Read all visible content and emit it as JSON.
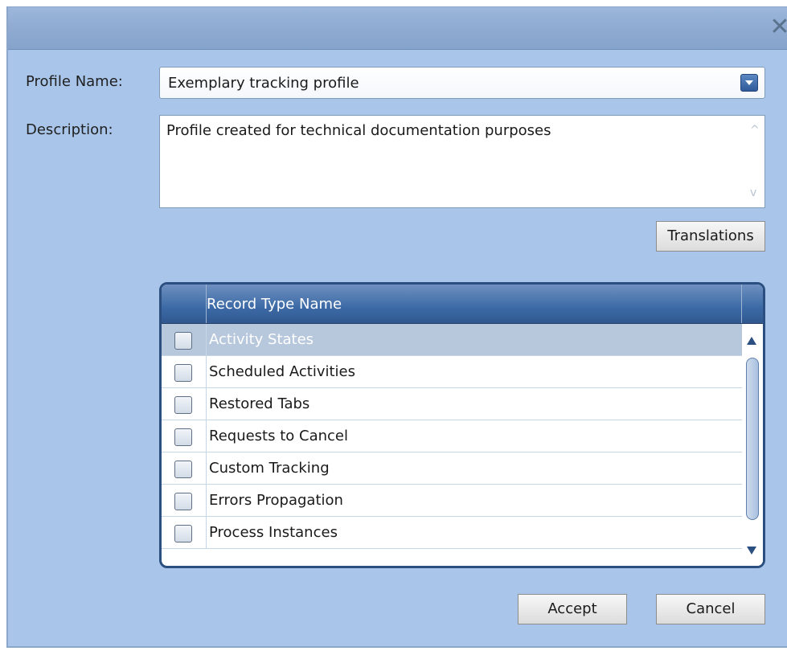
{
  "dialog": {
    "close_glyph": "✕",
    "profile_label": "Profile Name:",
    "profile_value": "Exemplary tracking profile",
    "description_label": "Description:",
    "description_value": "Profile created for technical documentation purposes",
    "translations_button": "Translations",
    "accept_button": "Accept",
    "cancel_button": "Cancel"
  },
  "grid": {
    "header": "Record Type Name",
    "rows": [
      {
        "name": "Activity States",
        "selected": true
      },
      {
        "name": "Scheduled Activities",
        "selected": false
      },
      {
        "name": "Restored Tabs",
        "selected": false
      },
      {
        "name": "Requests to Cancel",
        "selected": false
      },
      {
        "name": "Custom Tracking",
        "selected": false
      },
      {
        "name": "Errors Propagation",
        "selected": false
      },
      {
        "name": "Process Instances",
        "selected": false
      }
    ]
  },
  "colors": {
    "dialog_bg": "#a9c6ea",
    "header_blue": "#3c6aa6",
    "selected_row": "#b7c7dc"
  }
}
